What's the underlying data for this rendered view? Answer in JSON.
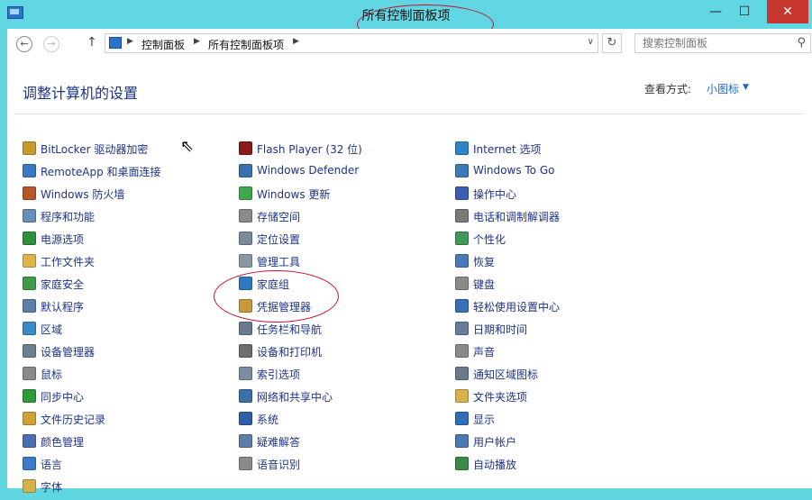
{
  "window": {
    "title": "所有控制面板项",
    "minimize_glyph": "—",
    "maximize_glyph": "☐",
    "close_glyph": "✕"
  },
  "addressbar": {
    "back_glyph": "←",
    "forward_glyph": "→",
    "up_glyph": "↑",
    "crumbs": [
      "控制面板",
      "所有控制面板项"
    ],
    "crumb_sep": "▶",
    "dropdown_glyph": "∨",
    "refresh_glyph": "↻",
    "search_placeholder": "搜索控制面板",
    "search_glyph": "⚲"
  },
  "content": {
    "heading": "调整计算机的设置",
    "view_by_label": "查看方式:",
    "view_by_value": "小图标",
    "view_by_arrow": "▼"
  },
  "columns": [
    [
      {
        "label": "BitLocker 驱动器加密",
        "icon": "bitlocker-icon",
        "color": "#c89a2e"
      },
      {
        "label": "RemoteApp 和桌面连接",
        "icon": "remoteapp-icon",
        "color": "#3a78c4"
      },
      {
        "label": "Windows 防火墙",
        "icon": "firewall-icon",
        "color": "#b8562a"
      },
      {
        "label": "程序和功能",
        "icon": "programs-icon",
        "color": "#6a8fb8"
      },
      {
        "label": "电源选项",
        "icon": "power-icon",
        "color": "#2e8f3e"
      },
      {
        "label": "工作文件夹",
        "icon": "work-folders-icon",
        "color": "#e0b24a"
      },
      {
        "label": "家庭安全",
        "icon": "family-safety-icon",
        "color": "#3f9a4a"
      },
      {
        "label": "默认程序",
        "icon": "default-programs-icon",
        "color": "#5c7fa8"
      },
      {
        "label": "区域",
        "icon": "region-icon",
        "color": "#3b8ac8"
      },
      {
        "label": "设备管理器",
        "icon": "device-manager-icon",
        "color": "#6d7e8f"
      },
      {
        "label": "鼠标",
        "icon": "mouse-icon",
        "color": "#8a8a8a"
      },
      {
        "label": "同步中心",
        "icon": "sync-center-icon",
        "color": "#2e9a3a"
      },
      {
        "label": "文件历史记录",
        "icon": "file-history-icon",
        "color": "#d2a23a"
      },
      {
        "label": "颜色管理",
        "icon": "color-management-icon",
        "color": "#4a6fb0"
      },
      {
        "label": "语言",
        "icon": "language-icon",
        "color": "#3a7cc8"
      },
      {
        "label": "字体",
        "icon": "fonts-icon",
        "color": "#d6b04a"
      }
    ],
    [
      {
        "label": "Flash Player (32 位)",
        "icon": "flash-player-icon",
        "color": "#8b1a1a"
      },
      {
        "label": "Windows Defender",
        "icon": "windows-defender-icon",
        "color": "#3a6fb0"
      },
      {
        "label": "Windows 更新",
        "icon": "windows-update-icon",
        "color": "#3fa84a"
      },
      {
        "label": "存储空间",
        "icon": "storage-spaces-icon",
        "color": "#8a8a8a"
      },
      {
        "label": "定位设置",
        "icon": "location-settings-icon",
        "color": "#7a8a9a"
      },
      {
        "label": "管理工具",
        "icon": "admin-tools-icon",
        "color": "#8a96a4"
      },
      {
        "label": "家庭组",
        "icon": "homegroup-icon",
        "color": "#2f78c0"
      },
      {
        "label": "凭据管理器",
        "icon": "credential-manager-icon",
        "color": "#c69a3a"
      },
      {
        "label": "任务栏和导航",
        "icon": "taskbar-icon",
        "color": "#6a7a8a"
      },
      {
        "label": "设备和打印机",
        "icon": "devices-printers-icon",
        "color": "#6e6e6e"
      },
      {
        "label": "索引选项",
        "icon": "indexing-options-icon",
        "color": "#7b8da0"
      },
      {
        "label": "网络和共享中心",
        "icon": "network-sharing-icon",
        "color": "#3a6fa8"
      },
      {
        "label": "系统",
        "icon": "system-icon",
        "color": "#2f5fa8"
      },
      {
        "label": "疑难解答",
        "icon": "troubleshooting-icon",
        "color": "#5b7ea8"
      },
      {
        "label": "语音识别",
        "icon": "speech-recognition-icon",
        "color": "#8a8a8a"
      }
    ],
    [
      {
        "label": "Internet 选项",
        "icon": "internet-options-icon",
        "color": "#2f84c8"
      },
      {
        "label": "Windows To Go",
        "icon": "windows-to-go-icon",
        "color": "#3a7ab8"
      },
      {
        "label": "操作中心",
        "icon": "action-center-icon",
        "color": "#3b5fb0"
      },
      {
        "label": "电话和调制解调器",
        "icon": "phone-modem-icon",
        "color": "#7a7a7a"
      },
      {
        "label": "个性化",
        "icon": "personalization-icon",
        "color": "#3f9a5a"
      },
      {
        "label": "恢复",
        "icon": "recovery-icon",
        "color": "#4a7ab8"
      },
      {
        "label": "键盘",
        "icon": "keyboard-icon",
        "color": "#8a8a8a"
      },
      {
        "label": "轻松使用设置中心",
        "icon": "ease-of-access-icon",
        "color": "#3a6fb8"
      },
      {
        "label": "日期和时间",
        "icon": "date-time-icon",
        "color": "#6a7a9a"
      },
      {
        "label": "声音",
        "icon": "sound-icon",
        "color": "#8a8a8a"
      },
      {
        "label": "通知区域图标",
        "icon": "notification-icons-icon",
        "color": "#6a7a8a"
      },
      {
        "label": "文件夹选项",
        "icon": "folder-options-icon",
        "color": "#d8b24a"
      },
      {
        "label": "显示",
        "icon": "display-icon",
        "color": "#2f6fb8"
      },
      {
        "label": "用户帐户",
        "icon": "user-accounts-icon",
        "color": "#4a7ab0"
      },
      {
        "label": "自动播放",
        "icon": "autoplay-icon",
        "color": "#3a8a4a"
      }
    ]
  ]
}
